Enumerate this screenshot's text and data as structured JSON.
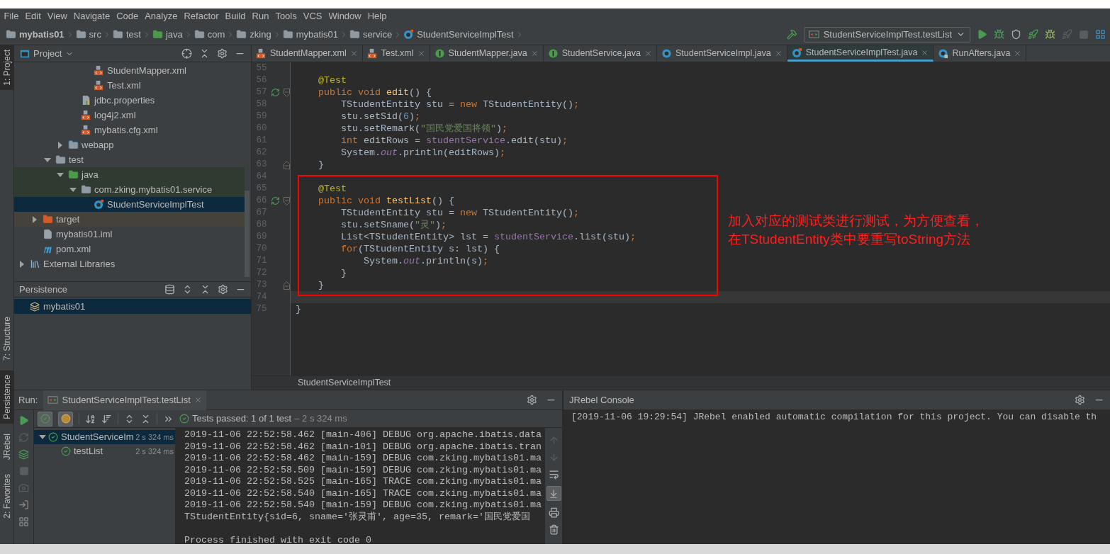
{
  "menu": [
    "File",
    "Edit",
    "View",
    "Navigate",
    "Code",
    "Analyze",
    "Refactor",
    "Build",
    "Run",
    "Tools",
    "VCS",
    "Window",
    "Help"
  ],
  "breadcrumb": [
    {
      "label": "mybatis01",
      "kind": "module"
    },
    {
      "label": "src",
      "kind": "folder"
    },
    {
      "label": "test",
      "kind": "folder"
    },
    {
      "label": "java",
      "kind": "test-root"
    },
    {
      "label": "com",
      "kind": "package"
    },
    {
      "label": "zking",
      "kind": "package"
    },
    {
      "label": "mybatis01",
      "kind": "package"
    },
    {
      "label": "service",
      "kind": "package"
    },
    {
      "label": "StudentServiceImplTest",
      "kind": "test-class"
    }
  ],
  "run_config": "StudentServiceImplTest.testList",
  "side_tabs_top": [
    {
      "label": "1: Project",
      "selected": true
    }
  ],
  "side_tabs_bottom": [
    {
      "label": "7: Structure",
      "selected": false
    },
    {
      "label": "Persistence",
      "selected": true
    },
    {
      "label": "JRebel",
      "selected": false
    },
    {
      "label": "2: Favorites",
      "selected": false
    }
  ],
  "project_panel": {
    "title": "Project"
  },
  "project_tree": [
    {
      "children": [
        {
          "children": [
            {
              "children": [
                {
                  "children": [
                    {
                      "children": [
                        {
                          "label": "StudentMapper.xml",
                          "kind": "xml",
                          "selected": false
                        },
                        {
                          "label": "Test.xml",
                          "kind": "xml",
                          "selected": false
                        }
                      ]
                    },
                    {
                      "label": "jdbc.properties",
                      "kind": "properties",
                      "selected": false
                    },
                    {
                      "label": "log4j2.xml",
                      "kind": "xml",
                      "selected": false
                    },
                    {
                      "label": "mybatis.cfg.xml",
                      "kind": "xml",
                      "selected": false
                    }
                  ]
                },
                {
                  "label": "webapp",
                  "kind": "web-folder",
                  "expanded": false,
                  "selected": false
                }
              ]
            },
            {
              "label": "test",
              "kind": "folder",
              "expanded": true,
              "selected": false,
              "children": [
                {
                  "label": "java",
                  "kind": "test-root",
                  "expanded": true,
                  "selected": false,
                  "color": "#2f3a30",
                  "children": [
                    {
                      "label": "com.zking.mybatis01.service",
                      "kind": "package",
                      "expanded": true,
                      "selected": false,
                      "color": "#2f3a30",
                      "children": [
                        {
                          "label": "StudentServiceImplTest",
                          "kind": "test-class",
                          "selected": true
                        }
                      ]
                    }
                  ]
                }
              ]
            }
          ]
        },
        {
          "label": "target",
          "kind": "excluded-folder",
          "expanded": false,
          "selected": false,
          "color": "#45413b"
        },
        {
          "label": "mybatis01.iml",
          "kind": "iml",
          "selected": false
        },
        {
          "label": "pom.xml",
          "kind": "maven",
          "selected": false
        }
      ]
    },
    {
      "label": "External Libraries",
      "kind": "library",
      "expanded": false,
      "selected": false
    }
  ],
  "persistence": {
    "title": "Persistence",
    "items": [
      {
        "label": "mybatis01",
        "selected": true
      }
    ]
  },
  "editor_tabs": [
    {
      "label": "StudentMapper.xml",
      "kind": "xml",
      "selected": false
    },
    {
      "label": "Test.xml",
      "kind": "xml",
      "selected": false
    },
    {
      "label": "StudentMapper.java",
      "kind": "interface",
      "selected": false
    },
    {
      "label": "StudentService.java",
      "kind": "interface",
      "selected": false
    },
    {
      "label": "StudentServiceImpl.java",
      "kind": "class",
      "selected": false
    },
    {
      "label": "StudentServiceImplTest.java",
      "kind": "test-class",
      "selected": true
    },
    {
      "label": "RunAfters.java",
      "kind": "locked-class",
      "selected": false
    }
  ],
  "code": [
    {
      "number": "55",
      "current": false,
      "run": false
    },
    {
      "number": "56",
      "current": false,
      "run": false,
      "tokens": [
        {
          "t": "    @Test",
          "kind": "annotation"
        }
      ]
    },
    {
      "number": "57",
      "current": false,
      "run": true,
      "fold": {
        "kind": "start"
      },
      "tokens": [
        {
          "t": "    public void ",
          "kind": "keyword"
        },
        {
          "t": "edit",
          "kind": "method"
        },
        {
          "t": "() {",
          "kind": "plain"
        }
      ]
    },
    {
      "number": "58",
      "current": false,
      "run": false,
      "tokens": [
        {
          "t": "        TStudentEntity stu = ",
          "kind": "plain"
        },
        {
          "t": "new",
          "kind": "keyword"
        },
        {
          "t": " TStudentEntity()",
          "kind": "plain"
        },
        {
          "t": ";",
          "kind": "keyword"
        }
      ]
    },
    {
      "number": "59",
      "current": false,
      "run": false,
      "tokens": [
        {
          "t": "        stu.setSid(",
          "kind": "plain"
        },
        {
          "t": "6",
          "kind": "number"
        },
        {
          "t": ")",
          "kind": "plain"
        },
        {
          "t": ";",
          "kind": "keyword"
        }
      ]
    },
    {
      "number": "60",
      "current": false,
      "run": false,
      "tokens": [
        {
          "t": "        stu.setRemark(",
          "kind": "plain"
        },
        {
          "t": "\"国民党爱国将领\"",
          "kind": "string"
        },
        {
          "t": ")",
          "kind": "plain"
        },
        {
          "t": ";",
          "kind": "keyword"
        }
      ]
    },
    {
      "number": "61",
      "current": false,
      "run": false,
      "tokens": [
        {
          "t": "        int",
          "kind": "keyword"
        },
        {
          "t": " editRows = ",
          "kind": "plain"
        },
        {
          "t": "studentService",
          "kind": "field"
        },
        {
          "t": ".edit(stu)",
          "kind": "plain"
        },
        {
          "t": ";",
          "kind": "keyword"
        }
      ]
    },
    {
      "number": "62",
      "current": false,
      "run": false,
      "tokens": [
        {
          "t": "        System.",
          "kind": "plain"
        },
        {
          "t": "out",
          "kind": "static"
        },
        {
          "t": ".println(editRows)",
          "kind": "plain"
        },
        {
          "t": ";",
          "kind": "keyword"
        }
      ]
    },
    {
      "number": "63",
      "current": false,
      "run": false,
      "fold": {
        "kind": "end"
      },
      "tokens": [
        {
          "t": "    }",
          "kind": "plain"
        }
      ]
    },
    {
      "number": "64",
      "current": false,
      "run": false
    },
    {
      "number": "65",
      "current": false,
      "run": false,
      "tokens": [
        {
          "t": "    @Test",
          "kind": "annotation"
        }
      ]
    },
    {
      "number": "66",
      "current": false,
      "run": true,
      "fold": {
        "kind": "start"
      },
      "tokens": [
        {
          "t": "    public void ",
          "kind": "keyword"
        },
        {
          "t": "testList",
          "kind": "method"
        },
        {
          "t": "() {",
          "kind": "plain"
        }
      ]
    },
    {
      "number": "67",
      "current": false,
      "run": false,
      "tokens": [
        {
          "t": "        TStudentEntity stu = ",
          "kind": "plain"
        },
        {
          "t": "new",
          "kind": "keyword"
        },
        {
          "t": " TStudentEntity()",
          "kind": "plain"
        },
        {
          "t": ";",
          "kind": "keyword"
        }
      ]
    },
    {
      "number": "68",
      "current": false,
      "run": false,
      "tokens": [
        {
          "t": "        stu.setSname(",
          "kind": "plain"
        },
        {
          "t": "\"灵\"",
          "kind": "string"
        },
        {
          "t": ")",
          "kind": "plain"
        },
        {
          "t": ";",
          "kind": "keyword"
        }
      ]
    },
    {
      "number": "69",
      "current": false,
      "run": false,
      "tokens": [
        {
          "t": "        List<TStudentEntity> lst = ",
          "kind": "plain"
        },
        {
          "t": "studentService",
          "kind": "field"
        },
        {
          "t": ".list(stu)",
          "kind": "plain"
        },
        {
          "t": ";",
          "kind": "keyword"
        }
      ]
    },
    {
      "number": "70",
      "current": false,
      "run": false,
      "tokens": [
        {
          "t": "        for",
          "kind": "keyword"
        },
        {
          "t": "(TStudentEntity s: lst) {",
          "kind": "plain"
        }
      ]
    },
    {
      "number": "71",
      "current": false,
      "run": false,
      "tokens": [
        {
          "t": "            System.",
          "kind": "plain"
        },
        {
          "t": "out",
          "kind": "static"
        },
        {
          "t": ".println(s)",
          "kind": "plain"
        },
        {
          "t": ";",
          "kind": "keyword"
        }
      ]
    },
    {
      "number": "72",
      "current": false,
      "run": false,
      "tokens": [
        {
          "t": "        }",
          "kind": "plain"
        }
      ]
    },
    {
      "number": "73",
      "current": false,
      "run": false,
      "fold": {
        "kind": "end"
      },
      "tokens": [
        {
          "t": "    }",
          "kind": "plain"
        }
      ]
    },
    {
      "number": "74",
      "current": true,
      "run": false
    },
    {
      "number": "75",
      "current": false,
      "run": false,
      "tokens": [
        {
          "t": "}",
          "kind": "plain"
        }
      ]
    }
  ],
  "annotation": {
    "lines": [
      "加入对应的测试类进行测试，为方便查看，",
      "在TStudentEntity类中要重写toString方法"
    ]
  },
  "editor_breadcrumb": "StudentServiceImplTest",
  "run_panel": {
    "label": "Run:",
    "tab": "StudentServiceImplTest.testList",
    "show_passed": true,
    "show_ignored": true,
    "status": "Tests passed: 1 of 1 test",
    "duration": "– 2 s 324 ms",
    "tests": [
      {
        "label": "StudentServiceIm",
        "duration": "2 s 324 ms",
        "kind": "passed",
        "expanded": true,
        "selected": true,
        "children": [
          {
            "label": "testList",
            "duration": "2 s 324 ms",
            "kind": "passed",
            "selected": false
          }
        ]
      }
    ],
    "console": [
      "2019-11-06 22:52:58.462 [main-406] DEBUG org.apache.ibatis.data",
      "2019-11-06 22:52:58.462 [main-101] DEBUG org.apache.ibatis.tran",
      "2019-11-06 22:52:58.462 [main-159] DEBUG com.zking.mybatis01.ma",
      "2019-11-06 22:52:58.509 [main-159] DEBUG com.zking.mybatis01.ma",
      "2019-11-06 22:52:58.525 [main-165] TRACE com.zking.mybatis01.ma",
      "2019-11-06 22:52:58.540 [main-165] TRACE com.zking.mybatis01.ma",
      "2019-11-06 22:52:58.540 [main-159] DEBUG com.zking.mybatis01.ma",
      "TStudentEntity{sid=6, sname='张灵甫', age=35, remark='国民党爱国"
    ],
    "console_footer": "Process finished with exit code 0"
  },
  "jrebel": {
    "title": "JRebel Console",
    "lines": [
      "[2019-11-06 19:29:54] JRebel enabled automatic compilation for this project. You can disable th"
    ]
  }
}
